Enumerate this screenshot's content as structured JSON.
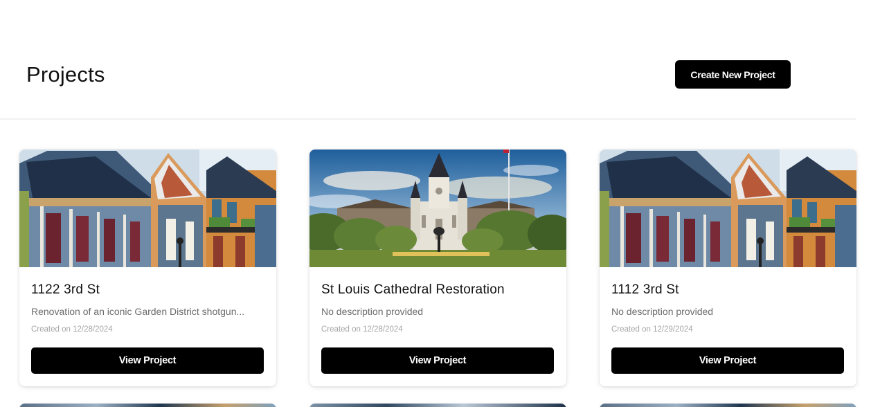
{
  "page": {
    "title": "Projects",
    "create_button_label": "Create New Project"
  },
  "projects": [
    {
      "title": "1122 3rd St",
      "description": "Renovation of an iconic Garden District shotgun...",
      "created": "Created on 12/28/2024",
      "button_label": "View Project",
      "image": "garden-district-houses-photo"
    },
    {
      "title": "St Louis Cathedral Restoration",
      "description": "No description provided",
      "created": "Created on 12/28/2024",
      "button_label": "View Project",
      "image": "st-louis-cathedral-photo"
    },
    {
      "title": "1112 3rd St",
      "description": "No description provided",
      "created": "Created on 12/29/2024",
      "button_label": "View Project",
      "image": "garden-district-houses-photo"
    }
  ],
  "colors": {
    "button_bg": "#000000",
    "button_text": "#ffffff",
    "muted_text": "#6b6b6b",
    "date_text": "#a5a5a5"
  }
}
